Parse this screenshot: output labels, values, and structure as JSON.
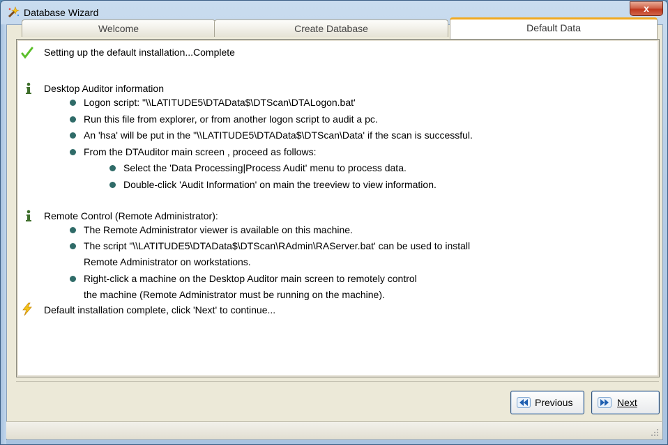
{
  "window": {
    "title": "Database Wizard",
    "close_label": "x"
  },
  "tabs": [
    {
      "label": "Welcome",
      "active": false
    },
    {
      "label": "Create Database",
      "active": false
    },
    {
      "label": "Default Data",
      "active": true
    }
  ],
  "content": {
    "status_line": "Setting up the default installation...Complete",
    "sections": [
      {
        "heading": "Desktop Auditor information",
        "bullets": [
          "Logon script: \"\\\\LATITUDE5\\DTAData$\\DTScan\\DTALogon.bat'",
          "Run this file from explorer, or from another logon script to audit a pc.",
          "An 'hsa' will be put in the \"\\\\LATITUDE5\\DTAData$\\DTScan\\Data' if the scan is successful.",
          "From the DTAuditor main screen , proceed as follows:"
        ],
        "sub_bullets": [
          "Select the 'Data Processing|Process Audit' menu to process data.",
          "Double-click 'Audit Information' on main the treeview to view information."
        ]
      },
      {
        "heading": "Remote Control (Remote Administrator):",
        "bullets": [
          "The Remote Administrator viewer is available on this machine.",
          "The script \"\\\\LATITUDE5\\DTAData$\\DTScan\\RAdmin\\RAServer.bat' can be used to install",
          "Right-click a machine on the Desktop Auditor main screen to remotely control"
        ],
        "continuations": [
          "Remote Administrator on workstations.",
          "the machine (Remote Administrator must be running on the machine)."
        ]
      }
    ],
    "final_line": "Default installation complete, click 'Next' to continue..."
  },
  "buttons": {
    "previous": "Previous",
    "next": "Next"
  },
  "colors": {
    "accent_tab": "#f7b32b",
    "bullet": "#2f6b68",
    "check": "#5bbf2a"
  }
}
